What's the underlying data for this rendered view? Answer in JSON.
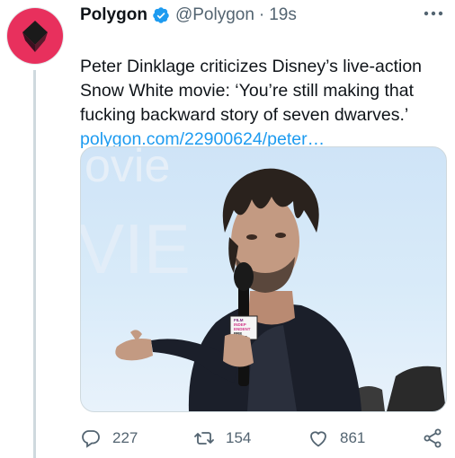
{
  "account": {
    "name": "Polygon",
    "handle": "@Polygon",
    "separator": "·",
    "time": "19s"
  },
  "tweet": {
    "text": "Peter Dinklage criticizes Disney’s live-action\nSnow White movie: ‘You’re still making that\nfucking backward story of seven dwarves.’",
    "link": "polygon.com/22900624/peter…"
  },
  "media": {
    "background_text_1": "ovie",
    "background_text_2": "VIE",
    "mic_flag_lines": [
      "FILM",
      "INDEP",
      "ENDENT",
      "PRE",
      "SENTS"
    ]
  },
  "actions": {
    "replies": "227",
    "retweets": "154",
    "likes": "861"
  },
  "colors": {
    "brand": "#e8305d",
    "accent": "#1d9bf0",
    "muted": "#536471"
  }
}
